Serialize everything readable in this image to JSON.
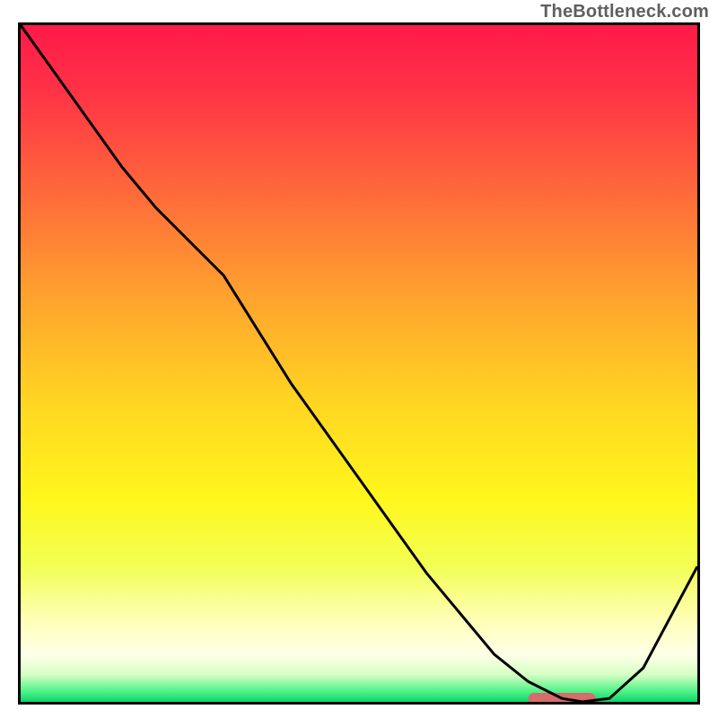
{
  "watermark": "TheBottleneck.com",
  "chart_data": {
    "type": "line",
    "title": "",
    "xlabel": "",
    "ylabel": "",
    "xlim": [
      0,
      100
    ],
    "ylim": [
      0,
      100
    ],
    "grid": false,
    "series": [
      {
        "name": "curve",
        "x": [
          0,
          5,
          10,
          15,
          20,
          25,
          30,
          35,
          40,
          45,
          50,
          55,
          60,
          65,
          70,
          75,
          80,
          83,
          87,
          92,
          100
        ],
        "values": [
          100,
          93,
          86,
          79,
          73,
          68,
          63,
          55,
          47,
          40,
          33,
          26,
          19,
          13,
          7,
          3,
          0.5,
          0,
          0.5,
          5,
          20
        ]
      }
    ],
    "gradient_stops": [
      {
        "offset": 0.0,
        "color": "#ff1a49"
      },
      {
        "offset": 0.1,
        "color": "#ff3346"
      },
      {
        "offset": 0.25,
        "color": "#ff6a3a"
      },
      {
        "offset": 0.4,
        "color": "#ffa22e"
      },
      {
        "offset": 0.55,
        "color": "#ffd323"
      },
      {
        "offset": 0.7,
        "color": "#fff71c"
      },
      {
        "offset": 0.8,
        "color": "#f2ff54"
      },
      {
        "offset": 0.88,
        "color": "#ffffb8"
      },
      {
        "offset": 0.93,
        "color": "#ffffe8"
      },
      {
        "offset": 0.96,
        "color": "#d5ffc4"
      },
      {
        "offset": 0.985,
        "color": "#4cf286"
      },
      {
        "offset": 1.0,
        "color": "#0ad468"
      }
    ],
    "indicator": {
      "x_start": 75,
      "x_end": 85,
      "y": 0,
      "color": "#d86b6c"
    }
  }
}
